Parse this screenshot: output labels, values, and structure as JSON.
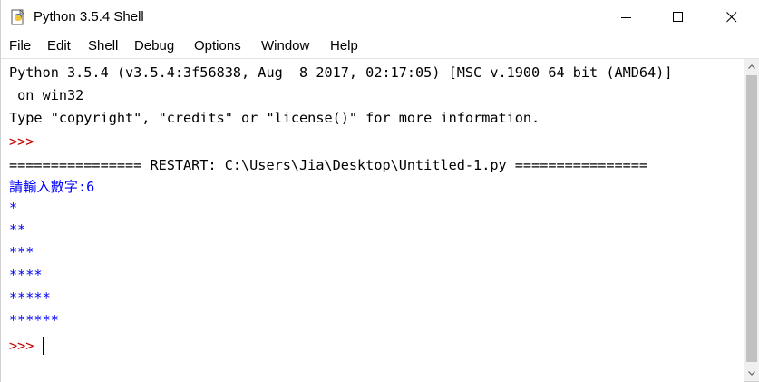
{
  "window": {
    "title": "Python 3.5.4 Shell",
    "icon": "python-idle-icon",
    "controls": {
      "minimize": "minimize-icon",
      "maximize": "maximize-icon",
      "close": "close-icon"
    }
  },
  "menu": [
    "File",
    "Edit",
    "Shell",
    "Debug",
    "Options",
    "Window",
    "Help"
  ],
  "shell": {
    "banner_line1": "Python 3.5.4 (v3.5.4:3f56838, Aug  8 2017, 02:17:05) [MSC v.1900 64 bit (AMD64)]",
    "banner_line2": " on win32",
    "banner_line3": "Type \"copyright\", \"credits\" or \"license()\" for more information.",
    "prompt1": ">>> ",
    "restart": "================ RESTART: C:\\Users\\Jia\\Desktop\\Untitled-1.py ================",
    "input_prompt": "請輸入數字:6",
    "output": [
      "*",
      "**",
      "***",
      "****",
      "*****",
      "******"
    ],
    "prompt2": ">>> "
  },
  "colors": {
    "prompt": "#c00000",
    "output": "#0000ff",
    "text": "#000000"
  }
}
